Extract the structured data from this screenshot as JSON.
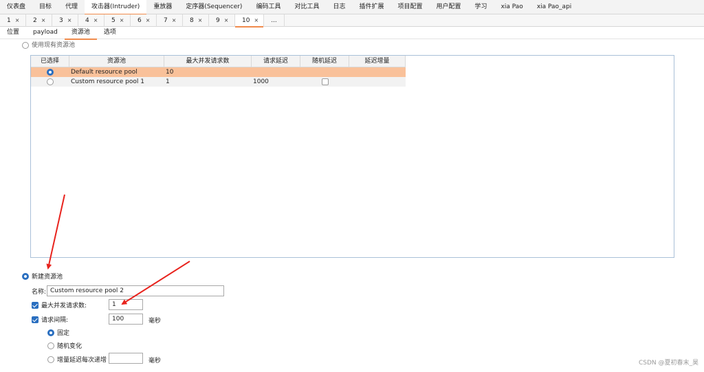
{
  "menu_tabs": [
    "仪表盘",
    "目标",
    "代理",
    "攻击器(Intruder)",
    "重放器",
    "定序器(Sequencer)",
    "编码工具",
    "对比工具",
    "日志",
    "插件扩展",
    "项目配置",
    "用户配置",
    "学习",
    "xia Pao",
    "xia Pao_api"
  ],
  "menu_active": "攻击器(Intruder)",
  "number_tabs": [
    "1",
    "2",
    "3",
    "4",
    "5",
    "6",
    "7",
    "8",
    "9",
    "10"
  ],
  "number_tab_close": "×",
  "number_tab_more": "...",
  "number_active": "10",
  "sub_tabs": [
    "位置",
    "payload",
    "资源池",
    "选项"
  ],
  "sub_active": "资源池",
  "use_existing_label": "使用现有资源池",
  "table": {
    "headers": [
      "已选择",
      "资源池",
      "最大并发请求数",
      "请求延迟",
      "随机延迟",
      "延迟增量"
    ],
    "rows": [
      {
        "pool": "Default resource pool",
        "max": "10",
        "delay": "",
        "selected": true
      },
      {
        "pool": "Custom resource pool 1",
        "max": "1",
        "delay": "1000",
        "selected": false
      }
    ]
  },
  "new_pool": {
    "label": "新建资源池",
    "name_label": "名称:",
    "name_value": "Custom resource pool 2",
    "max_label": "最大并发请求数:",
    "max_value": "1",
    "interval_label": "请求间隔:",
    "interval_value": "100",
    "unit": "毫秒",
    "fixed_label": "固定",
    "random_label": "随机变化",
    "increment_label": "增量延迟每次递增",
    "increment_value": "",
    "increment_unit": "毫秒"
  },
  "watermark": "CSDN @夏初春末_昊",
  "colors": {
    "accent": "#f08a4b",
    "selected_row": "#f9c19a",
    "radio_blue": "#2a6fc0",
    "arrow": "#e8231d"
  }
}
